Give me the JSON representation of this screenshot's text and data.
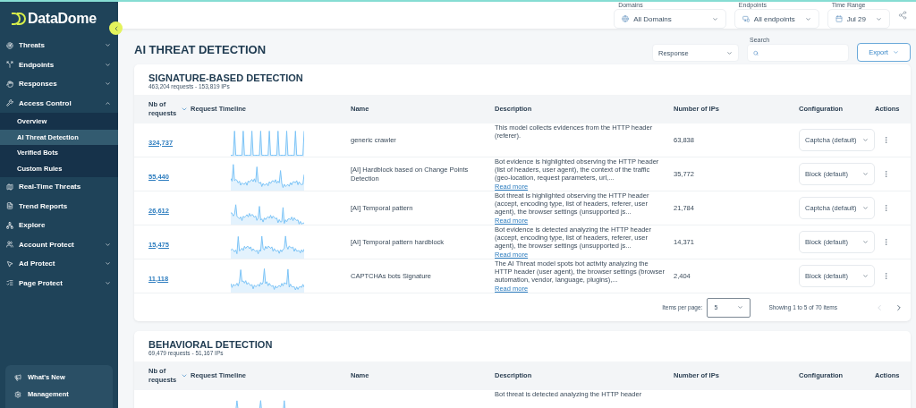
{
  "sidebar": {
    "logo": "DataDome",
    "items": [
      {
        "label": "Threats",
        "kind": "group",
        "expanded": false
      },
      {
        "label": "Endpoints",
        "kind": "group",
        "expanded": false
      },
      {
        "label": "Responses",
        "kind": "group",
        "expanded": false
      },
      {
        "label": "Access Control",
        "kind": "group",
        "expanded": true,
        "children": [
          {
            "label": "Overview",
            "selected": false
          },
          {
            "label": "AI Threat Detection",
            "selected": true
          },
          {
            "label": "Verified Bots",
            "selected": false
          },
          {
            "label": "Custom Rules",
            "selected": false
          }
        ]
      },
      {
        "label": "Real-Time Threats",
        "kind": "link"
      },
      {
        "label": "Trend Reports",
        "kind": "link"
      },
      {
        "label": "Explore",
        "kind": "link"
      },
      {
        "label": "Account Protect",
        "kind": "group",
        "expanded": false
      },
      {
        "label": "Ad Protect",
        "kind": "group",
        "expanded": false
      },
      {
        "label": "Page Protect",
        "kind": "group",
        "expanded": false
      }
    ],
    "footer_items": [
      "What's New",
      "Management"
    ]
  },
  "top_filters": [
    {
      "label": "Domains",
      "value": "All Domains"
    },
    {
      "label": "Endpoints",
      "value": "All endpoints"
    },
    {
      "label": "Time Range",
      "value": "Jul 29"
    }
  ],
  "page_title": "AI THREAT DETECTION",
  "toolbar": {
    "response_select": "Response",
    "search_label": "Search",
    "export_button": "Export"
  },
  "sections": [
    {
      "title": "SIGNATURE-BASED DETECTION",
      "summary": "463,204 requests - 153,819 IPs",
      "columns": [
        "Nb of requests",
        "Request Timeline",
        "Name",
        "Description",
        "Number of IPs",
        "Configuration",
        "Actions"
      ],
      "rows": [
        {
          "requests": "324,737",
          "name": "generic crawler",
          "description": "This model collects evidences from the HTTP header (referer).",
          "ips": "63,838",
          "configuration": "Captcha (default)"
        },
        {
          "requests": "55,440",
          "name": "[AI] Hardblock based on Change Points Detection",
          "description": "Bot evidence is highlighted observing the HTTP header (list of headers, user agent), the context of the traffic (geo-location, request parameters, url,...",
          "read_more": "Read more",
          "ips": "35,772",
          "configuration": "Block (default)"
        },
        {
          "requests": "26,612",
          "name": "[AI] Temporal pattern",
          "description": "Bot threat is highlighted observing the HTTP header (accept, encoding type, list of headers, referer, user agent), the browser settings (unsupported js...",
          "read_more": "Read more",
          "ips": "21,784",
          "configuration": "Captcha (default)"
        },
        {
          "requests": "15,475",
          "name": "[AI] Temporal pattern hardblock",
          "description": "Bot evidence is detected analyzing the HTTP header (accept, encoding type, list of headers, referer, user agent), the browser settings (unsupported js...",
          "read_more": "Read more",
          "ips": "14,371",
          "configuration": "Block (default)"
        },
        {
          "requests": "11,118",
          "name": "CAPTCHAs bots Signature",
          "description": "The AI Threat model spots bot activity analyzing the HTTP header (user agent), the browser settings (browser automation, vendor, language, plugins),...",
          "read_more": "Read more",
          "ips": "2,404",
          "configuration": "Block (default)"
        }
      ],
      "pagination": {
        "label": "Items per page:",
        "value": "5",
        "summary": "Showing 1 to 5 of 70 items",
        "prev_disabled": true,
        "next_disabled": false
      }
    },
    {
      "title": "BEHAVIORAL DETECTION",
      "summary": "69,479 requests - 51,167 IPs",
      "columns": [
        "Nb of requests",
        "Request Timeline",
        "Name",
        "Description",
        "Number of IPs",
        "Configuration",
        "Actions"
      ],
      "rows": [
        {
          "description": "Bot threat is detected analyzing the HTTP header"
        }
      ]
    }
  ]
}
